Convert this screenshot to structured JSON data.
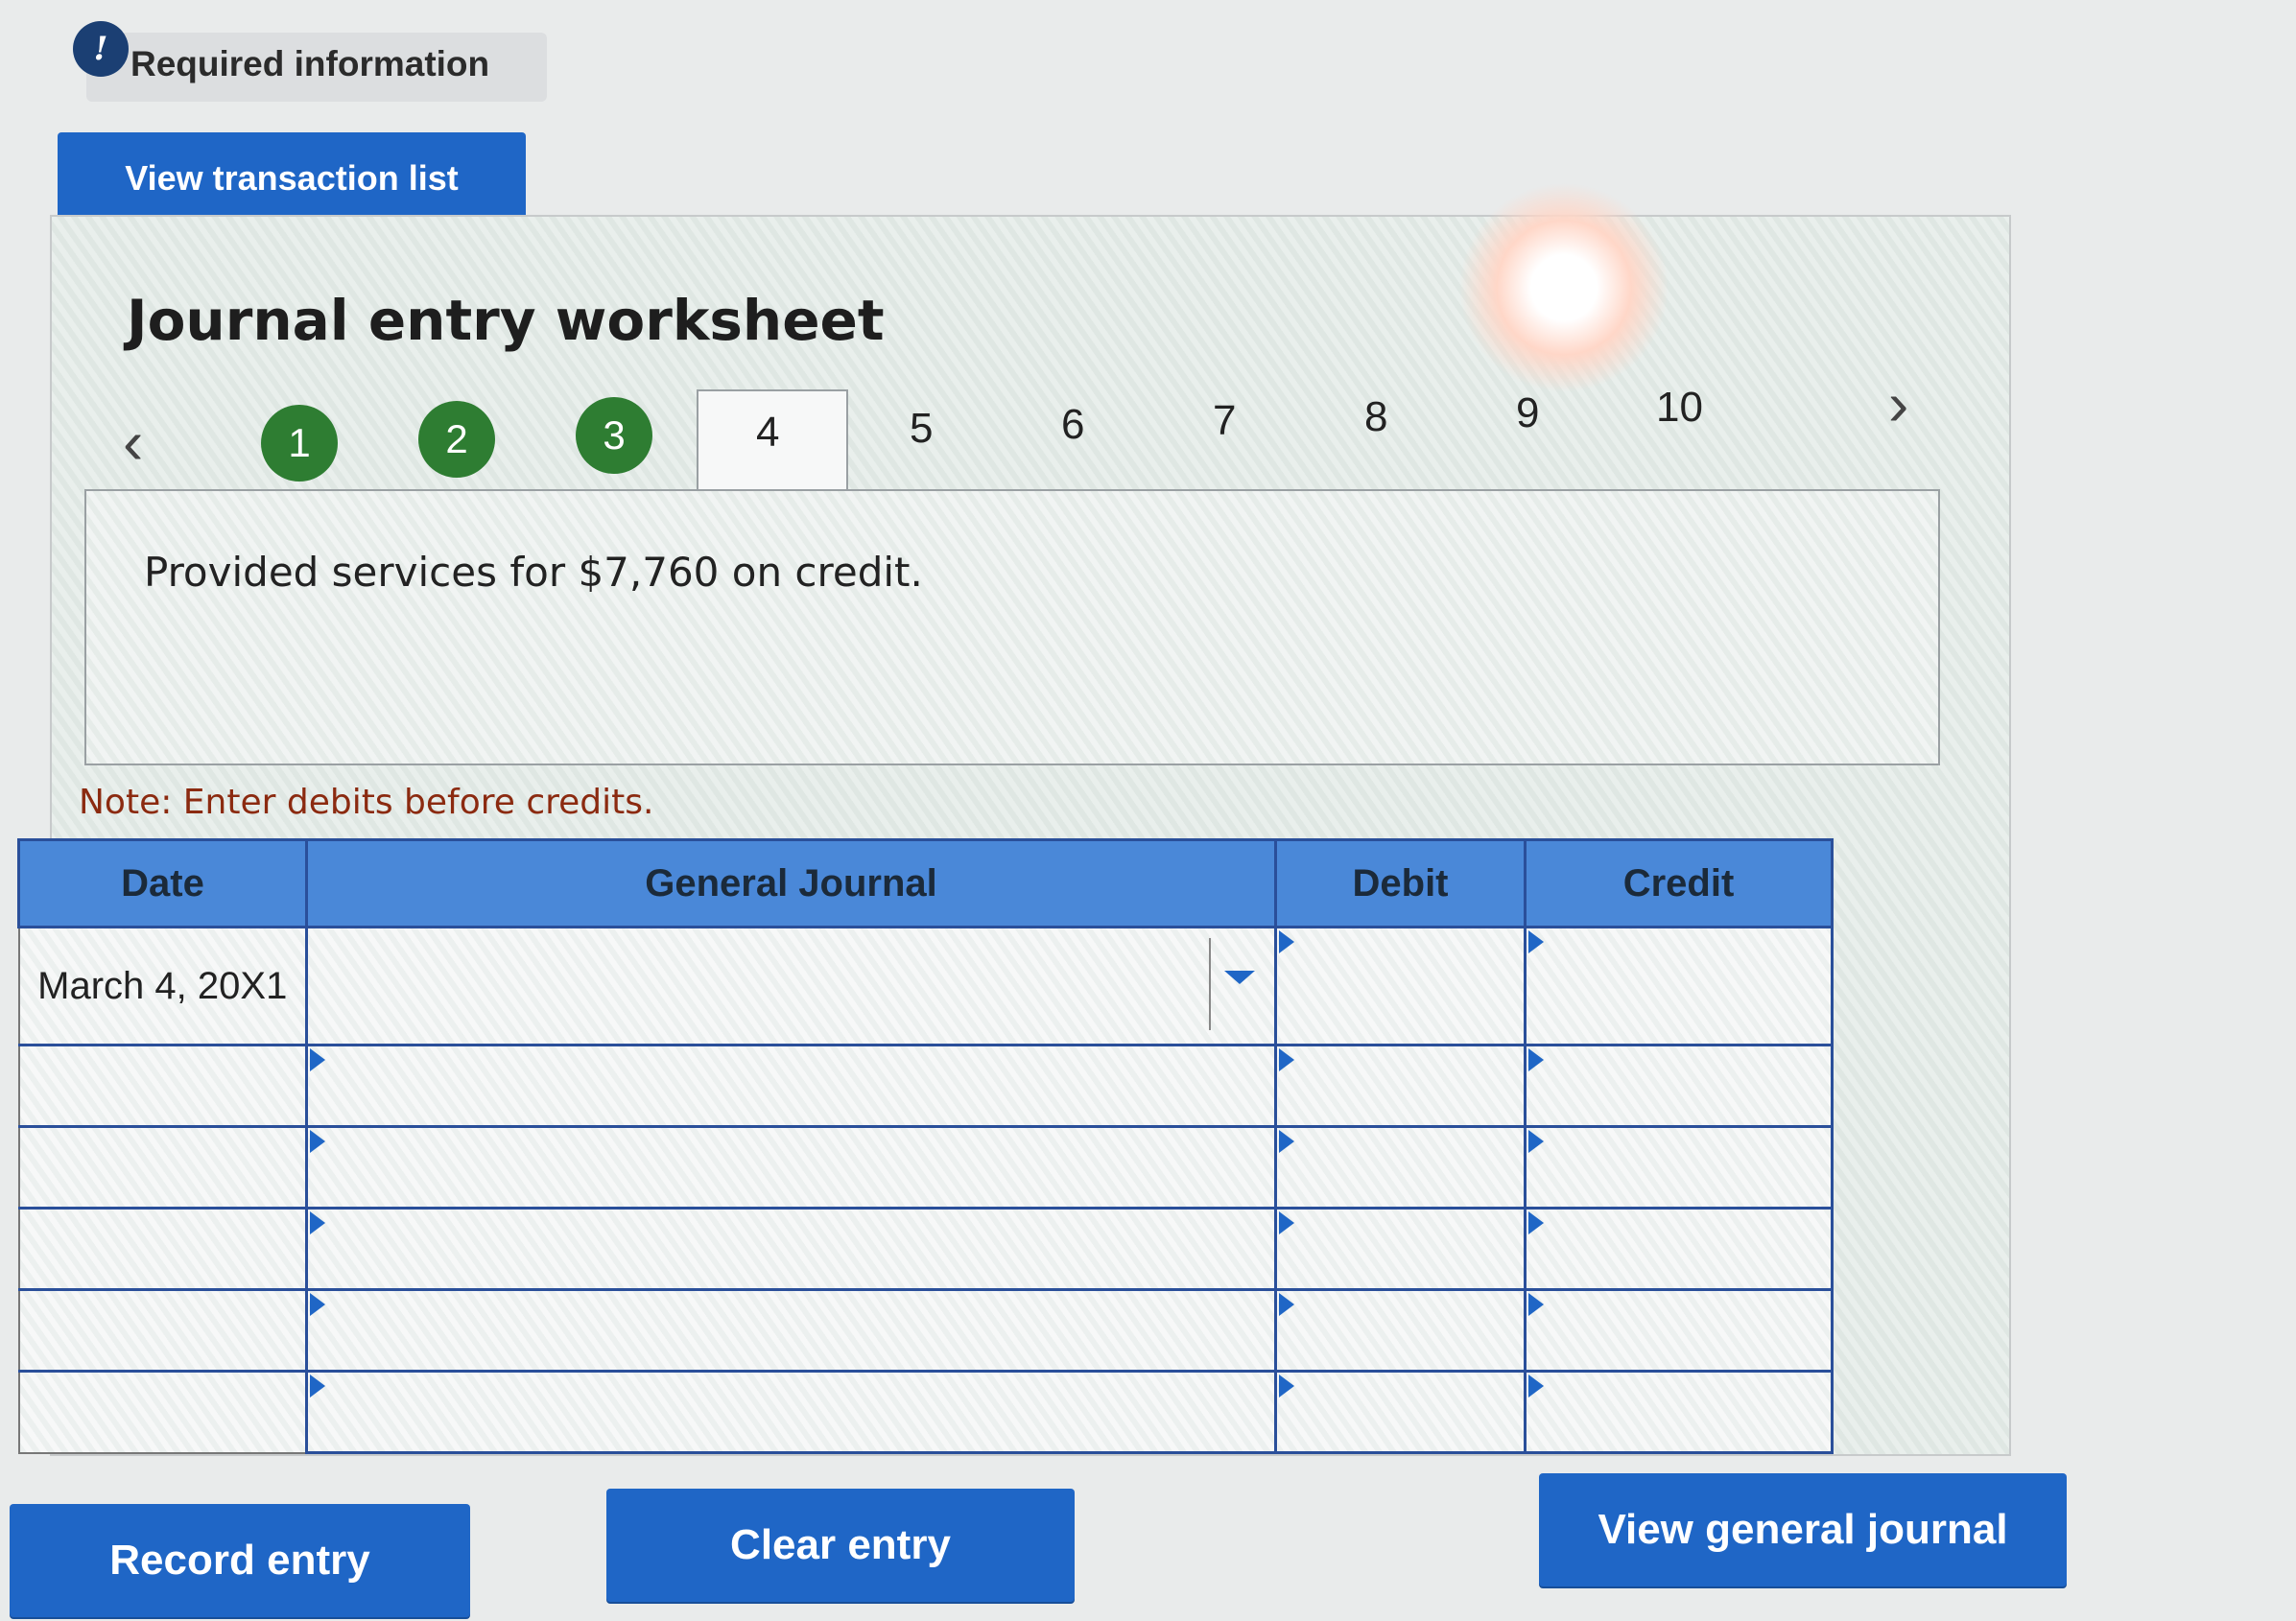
{
  "banner": {
    "icon": "!",
    "text": "Required information"
  },
  "view_transaction_button": "View transaction list",
  "worksheet": {
    "title": "Journal entry worksheet",
    "completed_steps": [
      "1",
      "2",
      "3"
    ],
    "active_tab": "4",
    "other_tabs": [
      "5",
      "6",
      "7",
      "8",
      "9",
      "10"
    ],
    "description": "Provided services for $7,760 on credit.",
    "note": "Note: Enter debits before credits."
  },
  "journal_table": {
    "headers": {
      "date": "Date",
      "general_journal": "General Journal",
      "debit": "Debit",
      "credit": "Credit"
    },
    "rows": [
      {
        "date": "March 4, 20X1",
        "account": "",
        "debit": "",
        "credit": ""
      },
      {
        "date": "",
        "account": "",
        "debit": "",
        "credit": ""
      },
      {
        "date": "",
        "account": "",
        "debit": "",
        "credit": ""
      },
      {
        "date": "",
        "account": "",
        "debit": "",
        "credit": ""
      },
      {
        "date": "",
        "account": "",
        "debit": "",
        "credit": ""
      },
      {
        "date": "",
        "account": "",
        "debit": "",
        "credit": ""
      }
    ]
  },
  "buttons": {
    "record": "Record entry",
    "clear": "Clear entry",
    "view_general_journal": "View general journal"
  },
  "colors": {
    "primary": "#1f66c6",
    "completed_step": "#2e7d32",
    "table_header": "#4a88d8",
    "note_text": "#8b2a10"
  },
  "icons": {
    "info": "exclamation-circle-icon",
    "prev": "chevron-left-icon",
    "next": "chevron-right-icon",
    "dropdown": "caret-down-icon"
  }
}
